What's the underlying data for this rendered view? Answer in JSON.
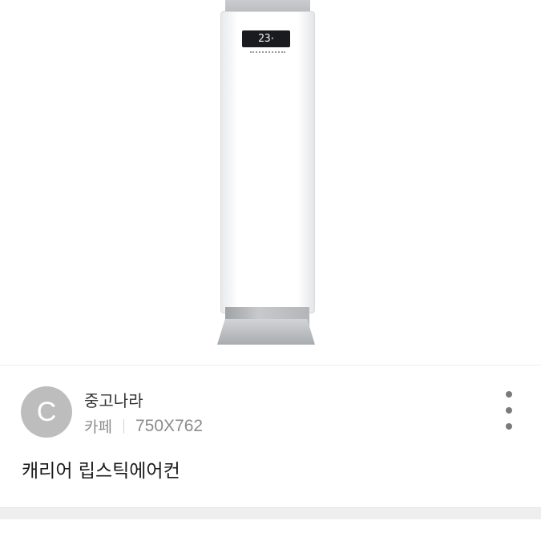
{
  "product_image": {
    "display_temp": "23",
    "display_unit": "°"
  },
  "result": {
    "avatar_letter": "C",
    "source_name": "중고나라",
    "source_type": "카페",
    "image_size": "750X762",
    "title": "캐리어 립스틱에어컨"
  },
  "icons": {
    "more": "more-vertical-icon"
  },
  "colors": {
    "avatar_bg": "#bdbdbd",
    "meta_text": "#8c8c8c"
  }
}
